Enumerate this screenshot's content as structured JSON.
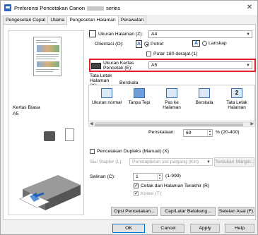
{
  "window": {
    "title_prefix": "Preferensi Pencetakan Canon",
    "title_suffix": "series",
    "close_glyph": "✕"
  },
  "tabs": [
    "Pengesetan Cepat",
    "Utama",
    "Pengesetan Halaman",
    "Perawatan"
  ],
  "active_tab_index": 2,
  "preview": {
    "media_type": "Kertas Biasa",
    "media_size": "A5"
  },
  "page_size": {
    "label": "Ukuran Halaman (Z):",
    "value": "A4"
  },
  "orientation": {
    "label": "Orientasi (O):",
    "options": [
      {
        "label": "Potret",
        "selected": true
      },
      {
        "label": "Lanskap",
        "selected": false
      }
    ],
    "rotate_label": "Putar 180 derajat (1)",
    "rotate_checked": false
  },
  "printer_paper_size": {
    "label": "Ukuran Kertas Pencetak (E):",
    "value": "A5"
  },
  "page_layout": {
    "label": "Tata Letak Halaman (Y):",
    "selected": "Berskala",
    "items": [
      "Ukuran normal",
      "Tanpa Tepi",
      "Pas ke Halaman",
      "Berskala",
      "Tata Letak Halaman"
    ]
  },
  "scaling": {
    "label": "Penskalaan:",
    "value": "69",
    "range": "% (20-400)"
  },
  "duplex": {
    "label": "Pencetakan Dupleks (Manual) (X)",
    "checked": false
  },
  "stapling": {
    "label": "Sisi Stapler (L):",
    "value": "Penstapleran sisi panjang (Kiri)",
    "margin_button": "Tentukan Margin..."
  },
  "copies": {
    "label": "Salinan (C):",
    "value": "1",
    "range": "(1-999)",
    "last_page_first": {
      "label": "Cetak dari Halaman Terakhir (R)",
      "checked": true
    },
    "collate": {
      "label": "Kolasi (T)",
      "checked": true
    }
  },
  "footer_buttons": [
    "Opsi Pencetakan...",
    "Cap/Latar Belakang...",
    "Setelan Asal (F)"
  ],
  "dialog_buttons": [
    "OK",
    "Cancel",
    "Apply",
    "Help"
  ],
  "colors": {
    "highlight": "#e0202a",
    "accent": "#0078d7",
    "disabled_text": "#9a9a9a"
  }
}
